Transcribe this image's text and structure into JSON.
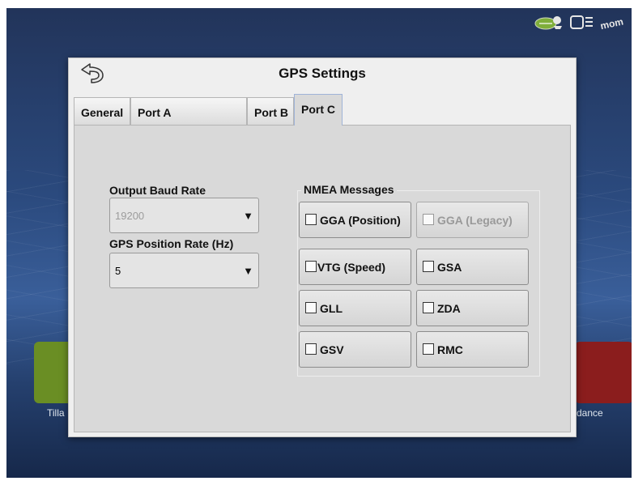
{
  "dialog": {
    "title": "GPS Settings"
  },
  "tabs": [
    {
      "label": "General",
      "active": false
    },
    {
      "label": "Port A",
      "active": false
    },
    {
      "label": "Port B",
      "active": false
    },
    {
      "label": "Port C",
      "active": true
    }
  ],
  "output_baud": {
    "label": "Output Baud Rate",
    "value": "19200",
    "disabled": true
  },
  "position_rate": {
    "label": "GPS Position Rate (Hz)",
    "value": "5"
  },
  "nmea": {
    "title": "NMEA Messages",
    "messages": [
      {
        "label": "GGA (Position)",
        "checked": false,
        "disabled": false
      },
      {
        "label": "GGA (Legacy)",
        "checked": false,
        "disabled": true
      },
      {
        "label": "VTG (Speed)",
        "checked": false,
        "disabled": false
      },
      {
        "label": "GSA",
        "checked": false,
        "disabled": false
      },
      {
        "label": "GLL",
        "checked": false,
        "disabled": false
      },
      {
        "label": "ZDA",
        "checked": false,
        "disabled": false
      },
      {
        "label": "GSV",
        "checked": false,
        "disabled": false
      },
      {
        "label": "RMC",
        "checked": false,
        "disabled": false
      }
    ]
  },
  "background_tiles": {
    "left_label": "Tilla",
    "right_label": "dance"
  },
  "status_icons": [
    "gps-satellite-icon",
    "display-icon",
    "network-icon"
  ],
  "colors": {
    "dialog_bg": "#efefef",
    "panel_bg": "#d9d9d9",
    "screen_bg": "#2b4a7e",
    "tile_left": "#6a8e24",
    "tile_right": "#8b1d1d"
  }
}
